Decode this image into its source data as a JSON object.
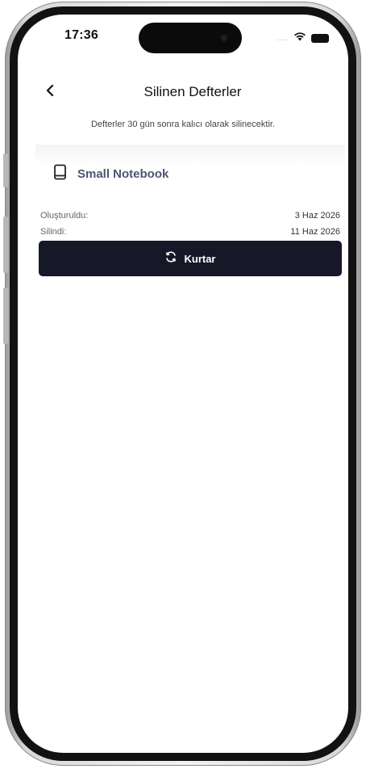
{
  "status_bar": {
    "time": "17:36",
    "signal": "....",
    "icons": [
      "wifi-icon",
      "battery-icon"
    ]
  },
  "header": {
    "title": "Silinen Defterler",
    "back_icon": "chevron-left-icon"
  },
  "info": {
    "text": "Defterler 30 gün sonra kalıcı olarak silinecektir."
  },
  "notebooks": [
    {
      "icon": "book-icon",
      "name": "Small Notebook",
      "created_label": "Oluşturuldu:",
      "created_value": "3 Haz 2026",
      "deleted_label": "Silindi:",
      "deleted_value": "11 Haz 2026",
      "restore_label": "Kurtar",
      "restore_icon": "refresh-icon"
    }
  ],
  "colors": {
    "button_bg": "#161827",
    "notebook_title": "#4c5670"
  }
}
